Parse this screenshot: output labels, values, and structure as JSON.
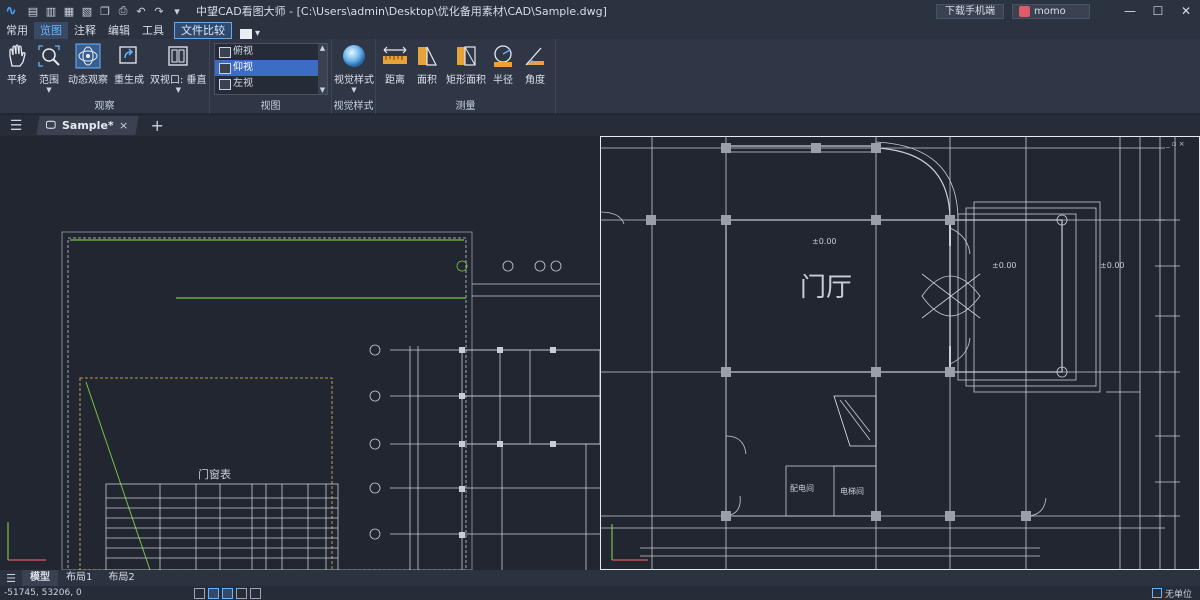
{
  "app": {
    "title": "中望CAD看图大师 - [C:\\Users\\admin\\Desktop\\优化备用素材\\CAD\\Sample.dwg]",
    "download_btn": "下载手机端",
    "user_name": "momo"
  },
  "menu": {
    "items": [
      "常用",
      "览图",
      "注释",
      "编辑",
      "工具",
      "文件比较"
    ],
    "active_index": 1
  },
  "ribbon": {
    "observe": {
      "label": "观察",
      "buttons": [
        "平移",
        "范围",
        "动态观察",
        "重生成",
        "双视口: 垂直"
      ]
    },
    "views": {
      "label": "视图",
      "items": [
        "俯视",
        "仰视",
        "左视"
      ],
      "selected_index": 1
    },
    "visual": {
      "label": "视觉样式",
      "button": "视觉样式"
    },
    "measure": {
      "label": "测量",
      "buttons": [
        "距离",
        "面积",
        "矩形面积",
        "半径",
        "角度"
      ]
    }
  },
  "tabs": {
    "doc": "Sample*",
    "close": "×",
    "add": "+"
  },
  "drawing": {
    "label_door_table": "门窗表",
    "labels": [
      "±0.00",
      "±0.00",
      "±0.00",
      "门厅",
      "配电间",
      "电梯间"
    ]
  },
  "layouts": [
    "模型",
    "布局1",
    "布局2"
  ],
  "status": {
    "coords": "-51745, 53206, 0",
    "unit": "无单位"
  },
  "colors": {
    "accent": "#64b4ff",
    "canvas": "#212631",
    "line": "#c8cdd6",
    "green": "#7bc142"
  }
}
